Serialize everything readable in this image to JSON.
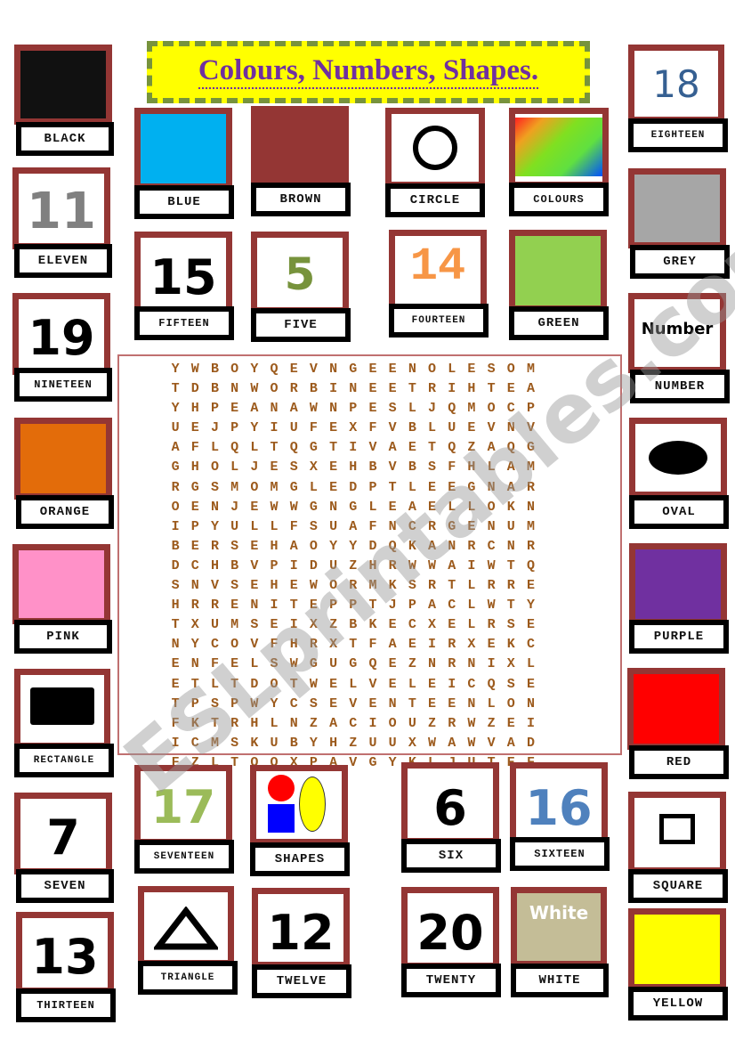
{
  "title": "Colours, Numbers, Shapes.",
  "watermark": "ESLprintables.com",
  "cards": {
    "black": {
      "label": "BLACK",
      "color": "#111111"
    },
    "eleven": {
      "label": "ELEVEN",
      "numeral": "11",
      "color": "#808080"
    },
    "nineteen": {
      "label": "NINETEEN",
      "numeral": "19",
      "color": "#000000"
    },
    "orange": {
      "label": "ORANGE",
      "color": "#e36c0a"
    },
    "pink": {
      "label": "PINK",
      "color": "#ff91c8"
    },
    "rectangle": {
      "label": "RECTANGLE"
    },
    "seven": {
      "label": "SEVEN",
      "numeral": "7",
      "color": "#000000"
    },
    "thirteen": {
      "label": "THIRTEEN",
      "numeral": "13",
      "color": "#000000"
    },
    "blue": {
      "label": "BLUE",
      "color": "#00b0f0"
    },
    "brown": {
      "label": "BROWN",
      "color": "#943634"
    },
    "circle": {
      "label": "CIRCLE"
    },
    "colours": {
      "label": "COLOURS"
    },
    "fifteen": {
      "label": "FIFTEEN",
      "numeral": "15",
      "color": "#000000"
    },
    "five": {
      "label": "FIVE",
      "numeral": "5",
      "color": "#77933c"
    },
    "fourteen": {
      "label": "FOURTEEN",
      "numeral": "14",
      "color": "#f79646"
    },
    "green": {
      "label": "GREEN",
      "color": "#92d050"
    },
    "eighteen": {
      "label": "EIGHTEEN",
      "numeral": "18",
      "color": "#366092"
    },
    "grey": {
      "label": "GREY",
      "color": "#a6a6a6"
    },
    "number": {
      "label": "NUMBER",
      "word": "Number"
    },
    "oval": {
      "label": "OVAL"
    },
    "purple": {
      "label": "PURPLE",
      "color": "#7030a0"
    },
    "red": {
      "label": "RED",
      "color": "#ff0000"
    },
    "square": {
      "label": "SQUARE"
    },
    "yellow": {
      "label": "YELLOW",
      "color": "#ffff00"
    },
    "seventeen": {
      "label": "SEVENTEEN",
      "numeral": "17",
      "color": "#9bbb59"
    },
    "shapes": {
      "label": "SHAPES"
    },
    "six": {
      "label": "SIX",
      "numeral": "6",
      "color": "#000000"
    },
    "sixteen": {
      "label": "SIXTEEN",
      "numeral": "16",
      "color": "#4f81bd"
    },
    "triangle": {
      "label": "TRIANGLE"
    },
    "twelve": {
      "label": "TWELVE",
      "numeral": "12",
      "color": "#000000"
    },
    "twenty": {
      "label": "TWENTY",
      "numeral": "20",
      "color": "#000000"
    },
    "white": {
      "label": "WHITE",
      "word": "White",
      "color": "#c4bd97"
    }
  },
  "wordsearch": {
    "rows": [
      "YWBOYQEVNGEENOLESOMT",
      "DBNWORBINEETRIHTEAYH",
      "PEANAWNPESLJQMOCPUEJ",
      "PYIUFEXFVBLUEVNVAFLQ",
      "LTQGTIVAETQZAQGGHOLJ",
      "ESXEHBVBSFHLAMRGSMOM",
      "GLEDPTLEEGNAROENJEWW",
      "GNGLEAELLOKNIPYULLFS",
      "UAFNCRGENUMBERSEHAOY",
      "YDQKANRCNRDCHBVPIDUZ",
      "HRWWAIWTQSNVSEHEWORM",
      "KSRTLRREHRRENITEPPTJ",
      "PACLWTYTXUMSEIXZBKEC",
      "XELRSENYCOVFHRXTFAEI",
      "RXEKCENFELSWGUGQEZNR",
      "NIXLETLTDOTWELVELEIC",
      "QSETPSPWYCSEVENTEENL",
      "ONFKTRHLNZACIOUZRWZE",
      "IICMSKUBYHZUUXWAWVAD",
      "FZLTQQXPAVGYKLJUTEFL"
    ]
  }
}
